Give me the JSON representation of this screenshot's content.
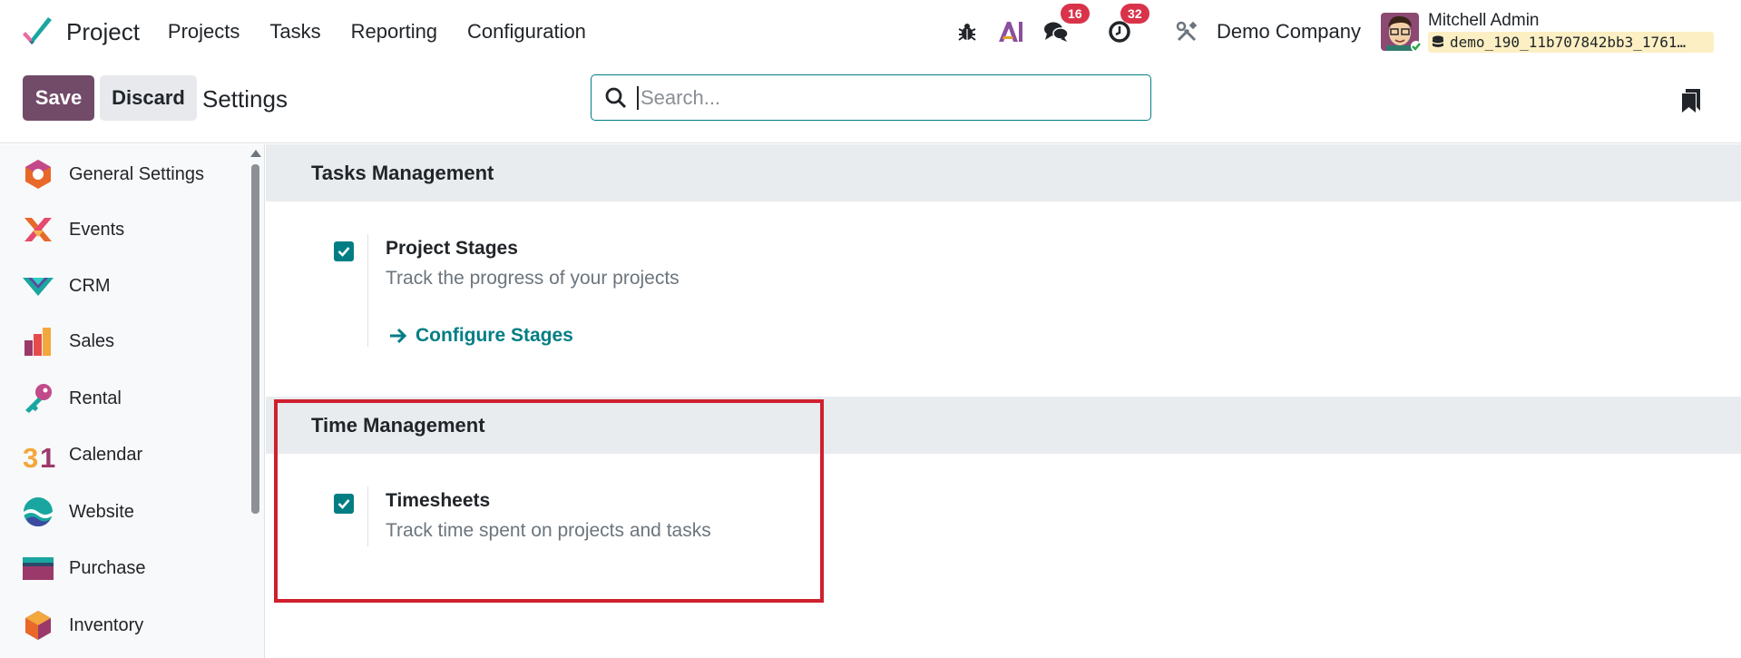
{
  "navbar": {
    "app_name": "Project",
    "menu": [
      "Projects",
      "Tasks",
      "Reporting",
      "Configuration"
    ],
    "messages_count": "16",
    "activities_count": "32",
    "company": "Demo Company",
    "user_name": "Mitchell Admin",
    "database": "demo_190_11b707842bb3_1761…"
  },
  "control": {
    "save_label": "Save",
    "discard_label": "Discard",
    "title": "Settings",
    "search_placeholder": "Search..."
  },
  "sidebar": {
    "items": [
      {
        "label": "General Settings",
        "icon": "general-settings-icon"
      },
      {
        "label": "Events",
        "icon": "events-icon"
      },
      {
        "label": "CRM",
        "icon": "crm-icon"
      },
      {
        "label": "Sales",
        "icon": "sales-icon"
      },
      {
        "label": "Rental",
        "icon": "rental-icon"
      },
      {
        "label": "Calendar",
        "icon": "calendar-icon"
      },
      {
        "label": "Website",
        "icon": "website-icon"
      },
      {
        "label": "Purchase",
        "icon": "purchase-icon"
      },
      {
        "label": "Inventory",
        "icon": "inventory-icon"
      }
    ]
  },
  "sections": [
    {
      "title": "Tasks Management",
      "settings": [
        {
          "title": "Project Stages",
          "description": "Track the progress of your projects",
          "checked": true,
          "link": "Configure Stages"
        }
      ]
    },
    {
      "title": "Time Management",
      "settings": [
        {
          "title": "Timesheets",
          "description": "Track time spent on projects and tasks",
          "checked": true
        }
      ]
    }
  ],
  "colors": {
    "brand_primary": "#714b67",
    "accent_teal": "#017e84",
    "badge_red": "#d9334a",
    "highlight_red": "#d0202e"
  }
}
